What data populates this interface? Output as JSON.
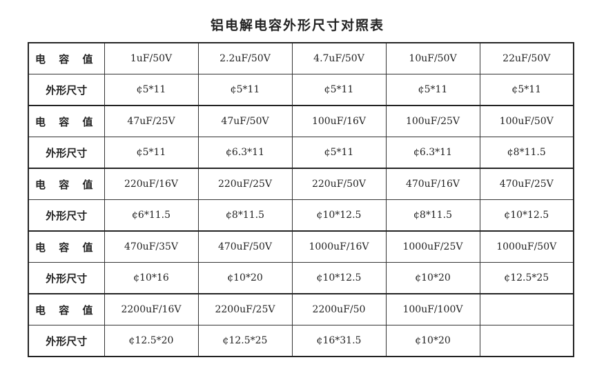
{
  "title": "铝电解电容外形尺寸对照表",
  "labels": {
    "capacity": "电 容 值",
    "size": "外形尺寸"
  },
  "groups": [
    {
      "capacities": [
        "1uF/50V",
        "2.2uF/50V",
        "4.7uF/50V",
        "10uF/50V",
        "22uF/50V"
      ],
      "sizes": [
        "¢5*11",
        "¢5*11",
        "¢5*11",
        "¢5*11",
        "¢5*11"
      ]
    },
    {
      "capacities": [
        "47uF/25V",
        "47uF/50V",
        "100uF/16V",
        "100uF/25V",
        "100uF/50V"
      ],
      "sizes": [
        "¢5*11",
        "¢6.3*11",
        "¢5*11",
        "¢6.3*11",
        "¢8*11.5"
      ]
    },
    {
      "capacities": [
        "220uF/16V",
        "220uF/25V",
        "220uF/50V",
        "470uF/16V",
        "470uF/25V"
      ],
      "sizes": [
        "¢6*11.5",
        "¢8*11.5",
        "¢10*12.5",
        "¢8*11.5",
        "¢10*12.5"
      ]
    },
    {
      "capacities": [
        "470uF/35V",
        "470uF/50V",
        "1000uF/16V",
        "1000uF/25V",
        "1000uF/50V"
      ],
      "sizes": [
        "¢10*16",
        "¢10*20",
        "¢10*12.5",
        "¢10*20",
        "¢12.5*25"
      ]
    },
    {
      "capacities": [
        "2200uF/16V",
        "2200uF/25V",
        "2200uF/50",
        "100uF/100V",
        ""
      ],
      "sizes": [
        "¢12.5*20",
        "¢12.5*25",
        "¢16*31.5",
        "¢10*20",
        ""
      ]
    }
  ]
}
